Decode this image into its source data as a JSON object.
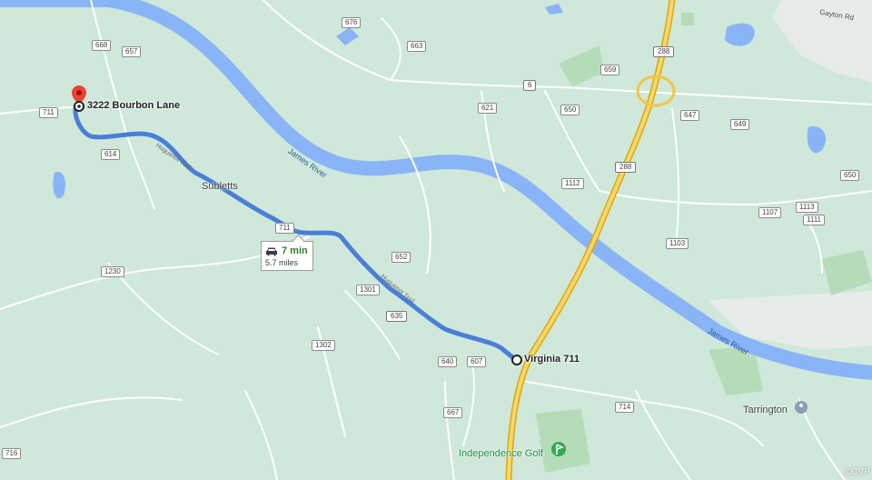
{
  "markers": {
    "origin": "3222 Bourbon Lane",
    "destination": "Virginia 711"
  },
  "trip": {
    "time": "7 min",
    "distance": "5.7 miles"
  },
  "places": {
    "subletts": "Subletts",
    "tarrington": "Tarrington",
    "independence_golf": "Independence Golf",
    "james_river_1": "James River",
    "james_river_2": "James River",
    "gayton_rd": "Gayton Rd",
    "road_name_1": "Huguenot Trail",
    "road_name_2": "Huguenot Trail"
  },
  "shields": {
    "r668": "668",
    "r657": "657",
    "r711a": "711",
    "r614": "614",
    "r676": "676",
    "r663": "663",
    "r6": "6",
    "r621": "621",
    "r650a": "650",
    "r659": "659",
    "r288a": "288",
    "r647": "647",
    "r649": "649",
    "r288b": "288",
    "r1112": "1112",
    "r650b": "650",
    "r1107": "1107",
    "r1113": "1113",
    "r1111": "1111",
    "r1103": "1103",
    "r711b": "711",
    "r652": "652",
    "r1230": "1230",
    "r1301": "1301",
    "r635": "635",
    "r1302": "1302",
    "r640": "640",
    "r607": "607",
    "r714": "714",
    "r667": "667",
    "r716": "716"
  },
  "copyright": "©CVP",
  "colors": {
    "land": "#cfe8d9",
    "water": "#8ab4f8",
    "route": "#4a7fd8",
    "highway": "#f2c744",
    "road": "#ffffff",
    "pin": "#ea4335",
    "trip_time": "#2e7d32"
  },
  "icons": {
    "pin": "map-pin-icon",
    "car": "car-icon",
    "golf": "golf-icon",
    "place": "place-marker-icon"
  }
}
